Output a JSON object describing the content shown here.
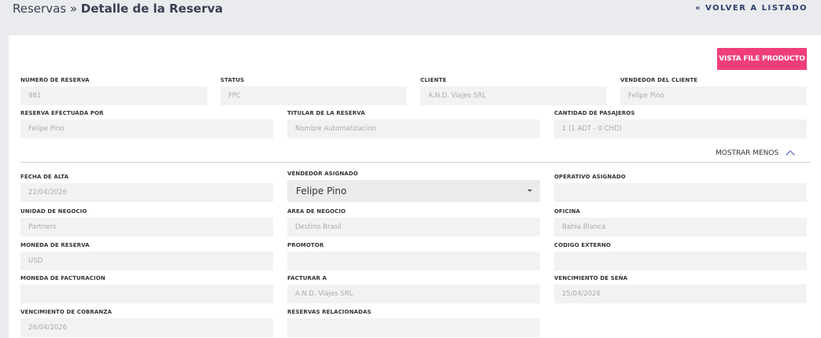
{
  "header": {
    "breadcrumb_parent": "Reservas",
    "breadcrumb_separator": " » ",
    "breadcrumb_current": "Detalle de la Reserva",
    "back_link": "« VOLVER A LISTADO"
  },
  "actions": {
    "vista_file_producto": "VISTA FILE PRODUCTO"
  },
  "summary": {
    "numero_reserva": {
      "label": "NUMERO DE RESERVA",
      "value": "981"
    },
    "status": {
      "label": "STATUS",
      "value": "FPC"
    },
    "cliente": {
      "label": "CLIENTE",
      "value": "A.N.D. Viajes SRL"
    },
    "vendedor_cliente": {
      "label": "VENDEDOR DEL CLIENTE",
      "value": "Felipe  Pino"
    },
    "reserva_efectuada_por": {
      "label": "RESERVA EFECTUADA POR",
      "value": "Felipe  Pino"
    },
    "titular_reserva": {
      "label": "TITULAR DE LA RESERVA",
      "value": "Nombre Automatizacion"
    },
    "cantidad_pasajeros": {
      "label": "CANTIDAD DE PASAJEROS",
      "value": "1 (1 ADT - 0 CHD)"
    }
  },
  "toggle": {
    "label": "MOSTRAR MENOS"
  },
  "details": {
    "fecha_alta": {
      "label": "FECHA DE ALTA",
      "value": "22/04/2026"
    },
    "vendedor_asignado": {
      "label": "VENDEDOR ASIGNADO",
      "value": "Felipe Pino"
    },
    "operativo_asignado": {
      "label": "OPERATIVO ASIGNADO",
      "value": ""
    },
    "unidad_negocio": {
      "label": "UNIDAD DE NEGOCIO",
      "value": "Partners"
    },
    "area_negocio": {
      "label": "AREA DE NEGOCIO",
      "value": "Destino Brasil"
    },
    "oficina": {
      "label": "OFICINA",
      "value": "Bahia Blanca"
    },
    "moneda_reserva": {
      "label": "MONEDA DE RESERVA",
      "value": "USD"
    },
    "promotor": {
      "label": "PROMOTOR",
      "value": ""
    },
    "codigo_externo": {
      "label": "CODIGO EXTERNO",
      "value": ""
    },
    "moneda_facturacion": {
      "label": "MONEDA DE FACTURACION",
      "value": ""
    },
    "facturar_a": {
      "label": "FACTURAR A",
      "value": "A.N.D. Viajes SRL"
    },
    "vencimiento_sena": {
      "label": "VENCIMIENTO DE SEÑA",
      "value": "25/04/2026"
    },
    "vencimiento_cobranza": {
      "label": "VENCIMIENTO DE COBRANZA",
      "value": "26/04/2026"
    },
    "reservas_relacionadas": {
      "label": "RESERVAS RELACIONADAS",
      "value": ""
    }
  }
}
